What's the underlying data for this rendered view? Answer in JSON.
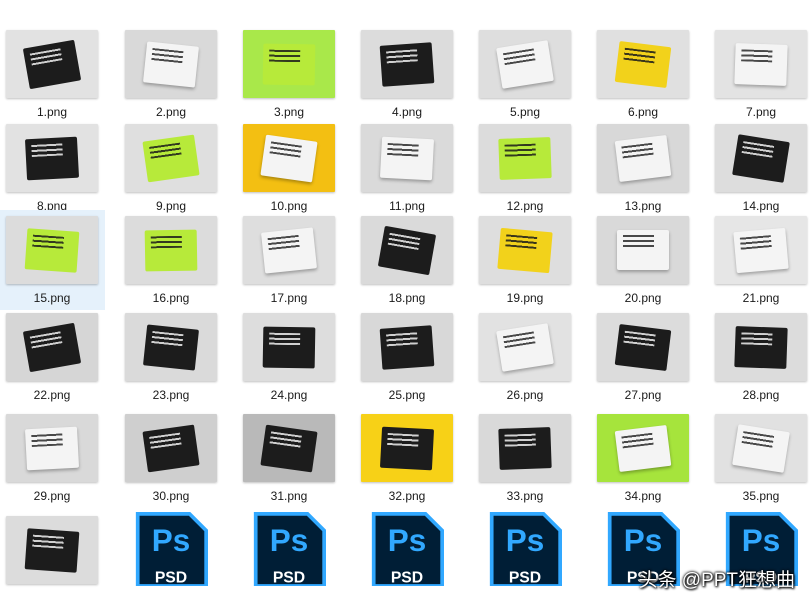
{
  "files": [
    {
      "label": "1.png",
      "bg": "#e2e2e2",
      "paper": "dark"
    },
    {
      "label": "2.png",
      "bg": "#d9d9d9",
      "paper": "light"
    },
    {
      "label": "3.png",
      "bg": "#a9e84a",
      "paper": "lime"
    },
    {
      "label": "4.png",
      "bg": "#dcdcdc",
      "paper": "dark"
    },
    {
      "label": "5.png",
      "bg": "#dedede",
      "paper": "light"
    },
    {
      "label": "6.png",
      "bg": "#e0e0e0",
      "paper": "yellow"
    },
    {
      "label": "7.png",
      "bg": "#e3e3e3",
      "paper": "light"
    },
    {
      "label": "8.png",
      "bg": "#e2e2e2",
      "paper": "dark"
    },
    {
      "label": "9.png",
      "bg": "#dfdfdf",
      "paper": "lime"
    },
    {
      "label": "10.png",
      "bg": "#f3bf12",
      "paper": "light"
    },
    {
      "label": "11.png",
      "bg": "#dadada",
      "paper": "light"
    },
    {
      "label": "12.png",
      "bg": "#dcdcdc",
      "paper": "lime"
    },
    {
      "label": "13.png",
      "bg": "#d8d8d8",
      "paper": "light"
    },
    {
      "label": "14.png",
      "bg": "#dddddd",
      "paper": "dark"
    },
    {
      "label": "15.png",
      "bg": "#dcdcdc",
      "paper": "lime"
    },
    {
      "label": "16.png",
      "bg": "#dcdcdc",
      "paper": "lime"
    },
    {
      "label": "17.png",
      "bg": "#dedede",
      "paper": "light"
    },
    {
      "label": "18.png",
      "bg": "#dadada",
      "paper": "dark"
    },
    {
      "label": "19.png",
      "bg": "#dedede",
      "paper": "yellow"
    },
    {
      "label": "20.png",
      "bg": "#d9d9d9",
      "paper": "light"
    },
    {
      "label": "21.png",
      "bg": "#e6e6e6",
      "paper": "light"
    },
    {
      "label": "22.png",
      "bg": "#d6d6d6",
      "paper": "dark"
    },
    {
      "label": "23.png",
      "bg": "#dadada",
      "paper": "dark"
    },
    {
      "label": "24.png",
      "bg": "#dddddd",
      "paper": "dark"
    },
    {
      "label": "25.png",
      "bg": "#d8d8d8",
      "paper": "dark"
    },
    {
      "label": "26.png",
      "bg": "#e2e2e2",
      "paper": "light"
    },
    {
      "label": "27.png",
      "bg": "#dcdcdc",
      "paper": "dark"
    },
    {
      "label": "28.png",
      "bg": "#dcdcdc",
      "paper": "dark"
    },
    {
      "label": "29.png",
      "bg": "#d9d9d9",
      "paper": "light"
    },
    {
      "label": "30.png",
      "bg": "#cfcfcf",
      "paper": "dark"
    },
    {
      "label": "31.png",
      "bg": "#b9b9b9",
      "paper": "dark"
    },
    {
      "label": "32.png",
      "bg": "#f7d117",
      "paper": "dark"
    },
    {
      "label": "33.png",
      "bg": "#d9d9d9",
      "paper": "dark"
    },
    {
      "label": "34.png",
      "bg": "#a6e43c",
      "paper": "light"
    },
    {
      "label": "35.png",
      "bg": "#e1e1e1",
      "paper": "light"
    },
    {
      "label": "",
      "bg": "#dcdcdc",
      "paper": "dark"
    },
    {
      "label": "",
      "type": "psd",
      "ps_text": "Ps",
      "psd_text": "PSD"
    },
    {
      "label": "",
      "type": "psd",
      "ps_text": "Ps",
      "psd_text": "PSD"
    },
    {
      "label": "",
      "type": "psd",
      "ps_text": "Ps",
      "psd_text": "PSD"
    },
    {
      "label": "",
      "type": "psd",
      "ps_text": "Ps",
      "psd_text": "PSD"
    },
    {
      "label": "",
      "type": "psd",
      "ps_text": "Ps",
      "psd_text": "PSD"
    },
    {
      "label": "",
      "type": "psd",
      "ps_text": "Ps",
      "psd_text": "PSD"
    }
  ],
  "selected_index": 14,
  "colors": {
    "selection": "#e5f1fb",
    "psd_blue": "#31a8ff",
    "psd_dark": "#001e36",
    "yellow": "#f2d21b"
  },
  "watermark": "头条 @PPT狂想曲"
}
